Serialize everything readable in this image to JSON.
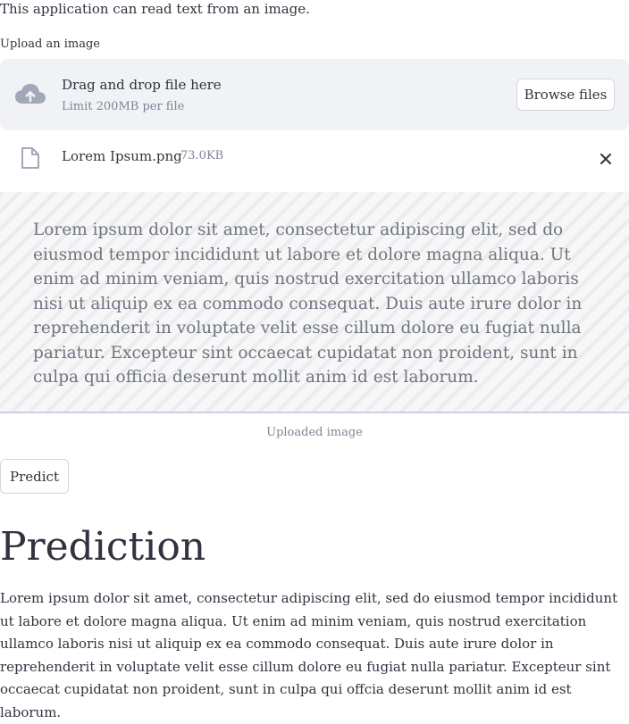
{
  "intro": {
    "text": "This application can read text from an image."
  },
  "uploader": {
    "label": "Upload an image",
    "drop_title": "Drag and drop file here",
    "limit": "Limit 200MB per file",
    "browse_label": "Browse files",
    "file": {
      "name": "Lorem Ipsum.png",
      "size": "73.0KB"
    }
  },
  "image_preview": {
    "text": "Lorem ipsum dolor sit amet, consectetur adipiscing elit, sed do eiusmod tempor incididunt ut labore et dolore magna aliqua. Ut enim ad minim veniam, quis nostrud exercitation ullamco laboris nisi ut aliquip ex ea commodo consequat. Duis aute irure dolor in reprehenderit in voluptate velit esse cillum dolore eu fugiat nulla pariatur. Excepteur sint occaecat cupidatat non proident, sunt in culpa qui officia deserunt mollit anim id est laborum.",
    "caption": "Uploaded image"
  },
  "predict_label": "Predict",
  "prediction": {
    "title": "Prediction",
    "text": "Lorem ipsum dolor sit amet, consectetur adipiscing elit, sed do eiusmod tempor incididunt ut labore et dolore magna aliqua. Ut enim ad minim veniam, quis nostrud exercitation ullamco laboris nisi ut aliquip ex ea commodo consequat. Duis aute irure dolor in reprehenderit in voluptate velit esse cillum dolore eu fugiat nulla pariatur. Excepteur sint occaecat cupidatat non proident, sunt in culpa qui offcia deserunt mollit anim id est laborum."
  },
  "icons": {
    "upload": "cloud-upload-icon",
    "file": "file-icon",
    "close": "close-icon"
  },
  "colors": {
    "text": "#31333f",
    "muted": "#808495",
    "dropzone_bg": "#f0f2f6",
    "border": "#d3d6dc"
  }
}
